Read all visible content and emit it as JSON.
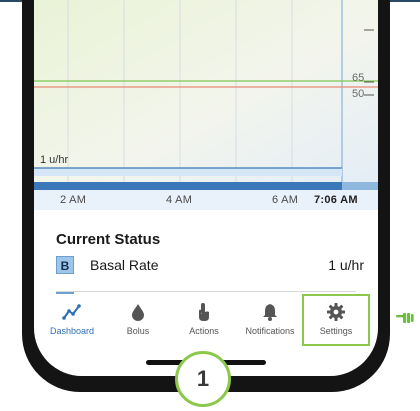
{
  "chart": {
    "threshold_high": "65",
    "threshold_low": "50",
    "basal_label": "1 u/hr",
    "time_ticks": [
      "2 AM",
      "4 AM",
      "6 AM"
    ],
    "current_time": "7:06 AM"
  },
  "status": {
    "title": "Current Status",
    "badge": "B",
    "label": "Basal Rate",
    "value": "1 u/hr"
  },
  "tabs": [
    {
      "label": "Dashboard",
      "icon": "dashboard-icon"
    },
    {
      "label": "Bolus",
      "icon": "drop-icon"
    },
    {
      "label": "Actions",
      "icon": "hand-icon"
    },
    {
      "label": "Notifications",
      "icon": "bell-icon"
    },
    {
      "label": "Settings",
      "icon": "gear-icon"
    }
  ],
  "step_number": "1",
  "colors": {
    "accent": "#2c6fb7",
    "highlight": "#8cc84b",
    "high_line": "#7ec850",
    "low_line": "#e58a73"
  }
}
